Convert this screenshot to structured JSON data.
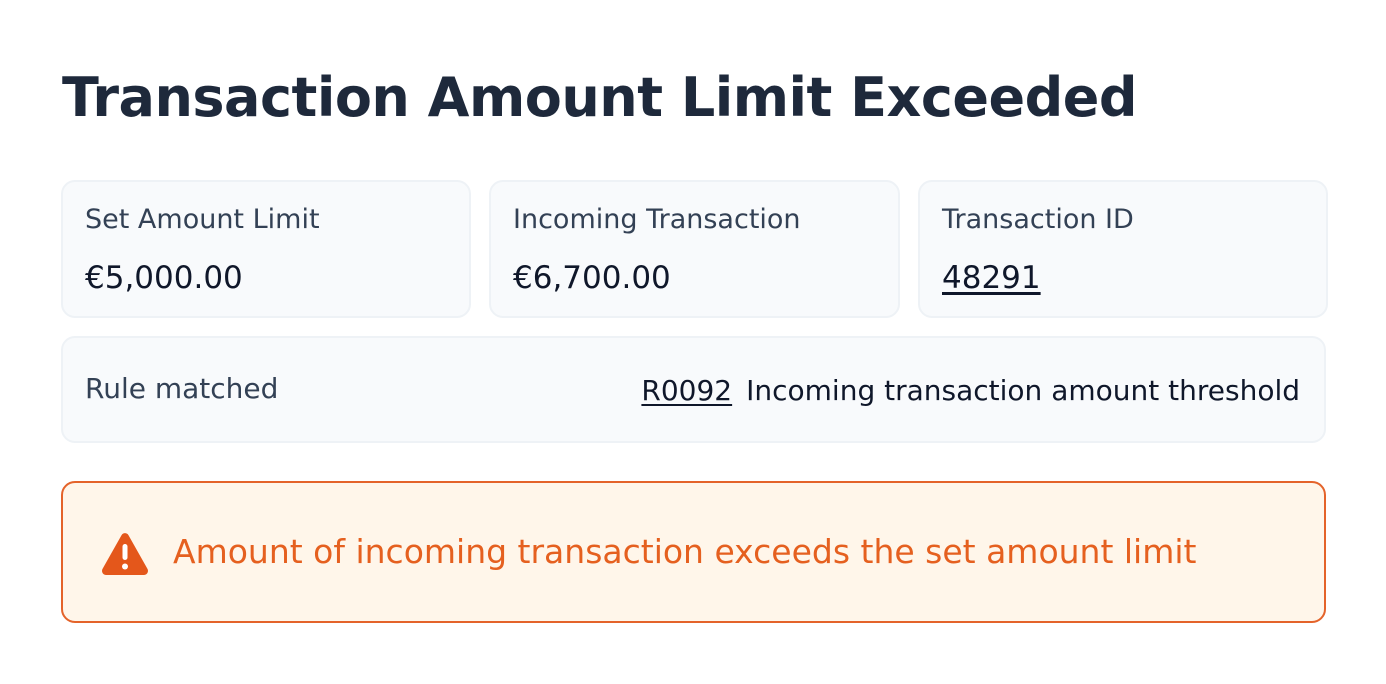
{
  "header": {
    "title": "Transaction Amount Limit Exceeded"
  },
  "summary": {
    "set_amount_limit": {
      "label": "Set Amount Limit",
      "value": "€5,000.00"
    },
    "incoming_transaction": {
      "label": "Incoming Transaction",
      "value": "€6,700.00"
    },
    "transaction_id": {
      "label": "Transaction ID",
      "value": "48291"
    }
  },
  "rule": {
    "label": "Rule matched",
    "id": "R0092",
    "description": "Incoming transaction amount threshold"
  },
  "alert": {
    "icon": "warning-triangle-icon",
    "message": "Amount of incoming transaction exceeds the set amount limit"
  },
  "colors": {
    "title": "#1e293b",
    "card_background": "#f8fafc",
    "card_border": "#eef2f6",
    "alert_background": "#fff6ea",
    "alert_border": "#e4632a",
    "alert_text": "#e5601f"
  }
}
